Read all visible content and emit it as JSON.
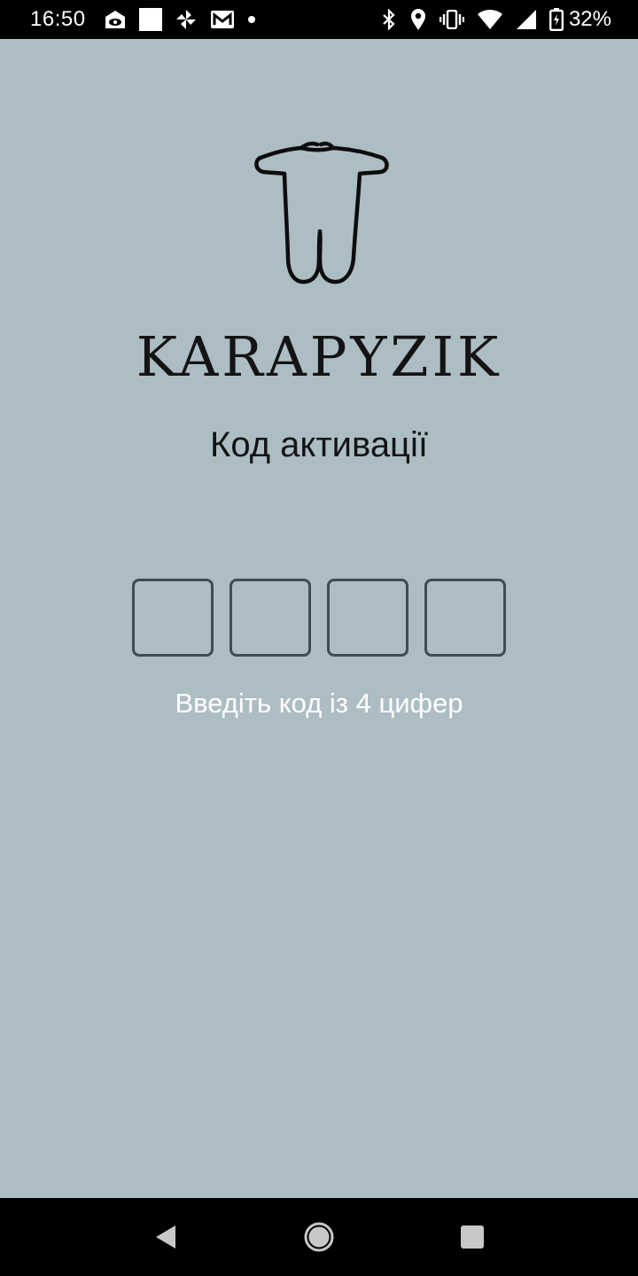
{
  "status_bar": {
    "time": "16:50",
    "left_icons": [
      "screen-share-icon",
      "white-square-icon",
      "pinwheel-icon",
      "gmail-icon",
      "dot-icon"
    ],
    "right_icons": [
      "bluetooth-icon",
      "location-icon",
      "vibrate-icon",
      "wifi-icon",
      "signal-icon",
      "battery-charging-icon"
    ],
    "battery_percent": "32%"
  },
  "app": {
    "brand_name": "KARAPYZIK",
    "logo_icon": "baby-onesie-icon",
    "title": "Код активації",
    "code_digits": [
      "",
      "",
      "",
      ""
    ],
    "hint": "Введіть код із 4 цифер"
  },
  "colors": {
    "background": "#adbdc4",
    "box_border": "#3d4d56",
    "hint_text": "#ffffff",
    "text_dark": "#141414"
  },
  "nav_bar": {
    "buttons": [
      "back-icon",
      "home-icon",
      "recents-icon"
    ]
  }
}
